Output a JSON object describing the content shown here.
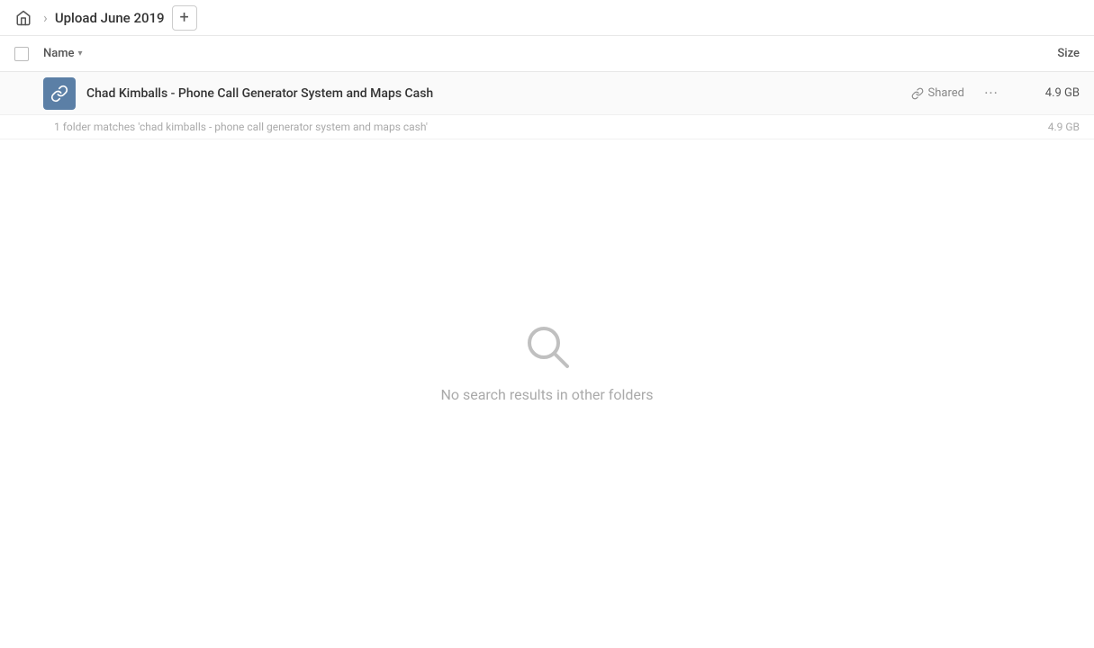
{
  "header": {
    "home_label": "Home",
    "breadcrumb_title": "Upload June 2019",
    "add_button_label": "+"
  },
  "table": {
    "name_column": "Name",
    "size_column": "Size"
  },
  "file_row": {
    "name": "Chad Kimballs - Phone Call Generator System and Maps Cash",
    "shared_label": "Shared",
    "more_label": "...",
    "size": "4.9 GB"
  },
  "matches_row": {
    "text": "1 folder matches 'chad kimballs - phone call generator system and maps cash'",
    "size": "4.9 GB"
  },
  "empty_state": {
    "message": "No search results in other folders"
  },
  "icons": {
    "home": "⌂",
    "separator": "›",
    "sort_down": "▾",
    "link": "🔗",
    "folder_link": "🔗"
  }
}
